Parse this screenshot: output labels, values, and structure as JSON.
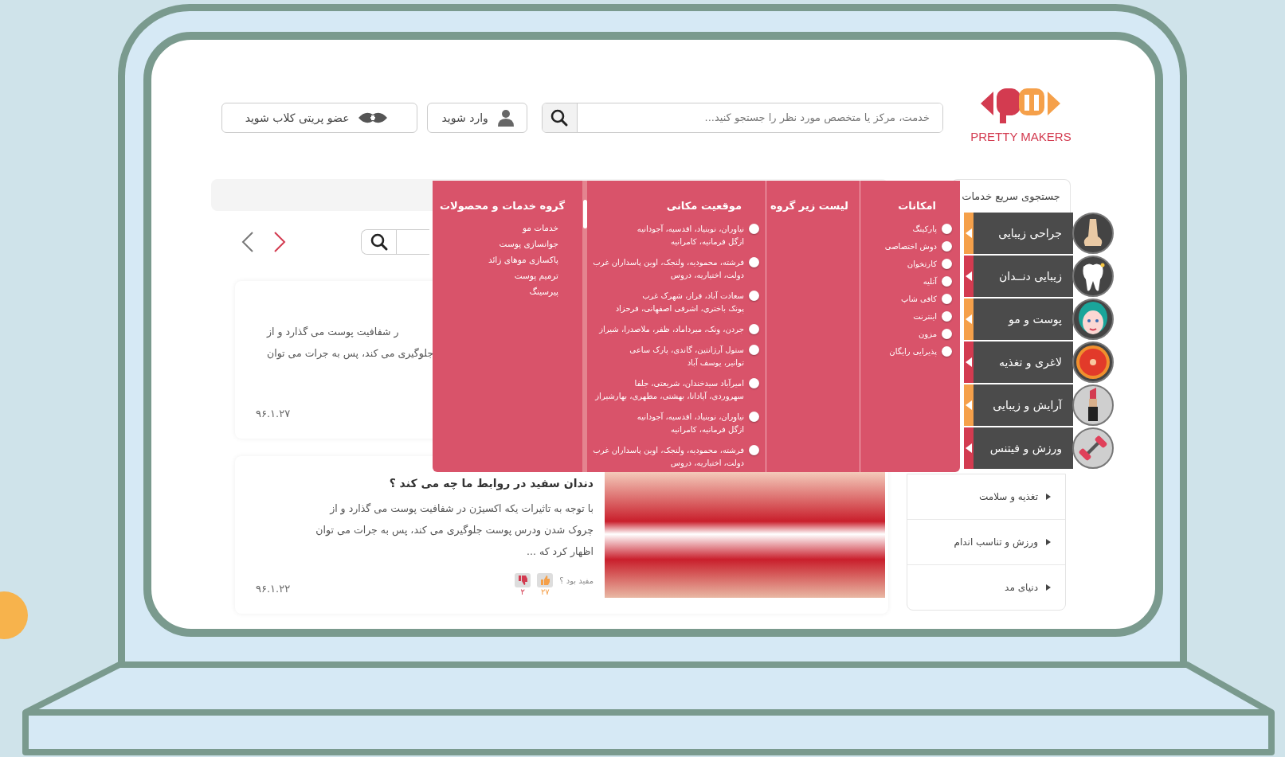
{
  "header": {
    "logo_text": "PRETTY MAKERS",
    "search": {
      "placeholder": "خدمت، مرکز یا متخصص مورد نظر را جستجو کنید..."
    },
    "login_button": "وارد شوید",
    "club_button": "عضو پریتی کلاب شوید"
  },
  "quick_search": {
    "title": "جستجوی سریع خدمات",
    "categories": [
      {
        "label": "جراحی زیبایی",
        "kind": "nose",
        "color": "#f5a04a"
      },
      {
        "label": "زیبایی دنــدان",
        "kind": "tooth",
        "color": "#d33b50"
      },
      {
        "label": "پوست و مو",
        "kind": "face",
        "color": "#f5a04a"
      },
      {
        "label": "لاغری و تغذیه",
        "kind": "grapefruit",
        "color": "#d33b50"
      },
      {
        "label": "آرایش و زیبایی",
        "kind": "lipstick",
        "color": "#f5a04a"
      },
      {
        "label": "ورزش و فیتنس",
        "kind": "dumbbell",
        "color": "#d33b50"
      }
    ],
    "links": [
      "تغذیه و سلامت",
      "ورزش و تناسب اندام",
      "دنیای مد"
    ]
  },
  "mega_menu": {
    "columns": [
      {
        "kind": "bullets",
        "title": "امکانات",
        "items": [
          {
            "lines": [
              "پارکینگ"
            ]
          },
          {
            "lines": [
              "دوش اختصاصی"
            ]
          },
          {
            "lines": [
              "کارتخوان"
            ]
          },
          {
            "lines": [
              "آتلیه"
            ]
          },
          {
            "lines": [
              "کافی شاپ"
            ]
          },
          {
            "lines": [
              "اینترنت"
            ]
          },
          {
            "lines": [
              "مزون"
            ]
          },
          {
            "lines": [
              "پذیرایی رایگان"
            ]
          }
        ]
      },
      {
        "kind": "bullets",
        "title": "لیست زیر گروه"
      },
      {
        "kind": "bullets",
        "title": "موقعیت مکانی",
        "items": [
          {
            "lines": [
              "نیاوران، نوبنیاد، اقدسیه، آجودانیه",
              "ازگل فرمانیه، کامرانیه"
            ]
          },
          {
            "lines": [
              "فرشته، محمودیه، ولنجک، اوین پاسداران غرب",
              "دولت، اختیاریه، دروس"
            ]
          },
          {
            "lines": [
              "سعادت آباد، فراز، شهرک غرب",
              "پونک باختری، اشرفی اصفهانی، فرحزاد"
            ]
          },
          {
            "lines": [
              "جردن، ونک، میرداماد، ظفر، ملاصدرا، شیراز"
            ]
          },
          {
            "lines": [
              "ستول آرژانتین، گاندی، پارک ساعی",
              "توانیر، یوسف آباد"
            ]
          },
          {
            "lines": [
              "امیرآباد سیدخندان، شریعتی، جلفا",
              "سهروردی، آپادانا، بهشتی، مطهری، بهارشیراز"
            ]
          },
          {
            "lines": [
              "نیاوران، نوبنیاد، اقدسیه، آجودانیه",
              "ازگل فرمانیه، کامرانیه"
            ]
          },
          {
            "lines": [
              "فرشته، محمودیه، ولنجک، اوین پاسداران غرب",
              "دولت، اختیاریه، دروس"
            ]
          }
        ]
      },
      {
        "kind": "links",
        "title": "گروه خدمات و محصولات",
        "items": [
          {
            "lines": [
              "خدمات مو"
            ]
          },
          {
            "lines": [
              "جوانسازی پوست"
            ]
          },
          {
            "lines": [
              "پاکسازی موهای زائد"
            ]
          },
          {
            "lines": [
              "ترمیم پوست"
            ]
          },
          {
            "lines": [
              "پیرسینگ"
            ]
          }
        ]
      }
    ]
  },
  "articles": [
    {
      "body_lines": [
        "ر شفافیت پوست می گذارد و از",
        "جلوگیری می کند، پس به جرات می توان"
      ],
      "date": "۹۶.۱.۲۷"
    },
    {
      "title": "دندان سفید در روابط ما چه می کند ؟",
      "body_lines": [
        "با توجه به تاثیرات یکه اکسیژن در شفافیت پوست می گذارد و از",
        "چروک شدن ودرس پوست جلوگیری می کند، پس به جرات می توان",
        "اظهار کرد که ..."
      ],
      "helpful_label": "مفید بود ؟",
      "likes": "۲۷",
      "dislikes": "۲",
      "date": "۹۶.۱.۲۲",
      "photo": true
    }
  ]
}
